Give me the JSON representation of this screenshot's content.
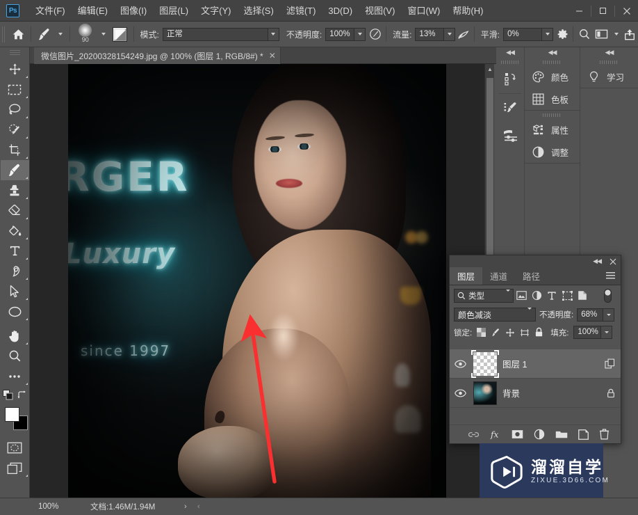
{
  "app": {
    "logo": "Ps",
    "name": "Adobe Photoshop"
  },
  "menubar": {
    "items": [
      {
        "label": "文件(F)"
      },
      {
        "label": "编辑(E)"
      },
      {
        "label": "图像(I)"
      },
      {
        "label": "图层(L)"
      },
      {
        "label": "文字(Y)"
      },
      {
        "label": "选择(S)"
      },
      {
        "label": "滤镜(T)"
      },
      {
        "label": "3D(D)"
      },
      {
        "label": "视图(V)"
      },
      {
        "label": "窗口(W)"
      },
      {
        "label": "帮助(H)"
      }
    ],
    "window_controls": {
      "minimize": "—",
      "maximize": "□",
      "close": "✕"
    }
  },
  "options_bar": {
    "home_icon": "home-icon",
    "brush_preset_icon": "brush-icon",
    "brush_size": "90",
    "brush_panel_icon": "brush-settings-icon",
    "mode_label": "模式:",
    "mode_value": "正常",
    "opacity_label": "不透明度:",
    "opacity_value": "100%",
    "pressure_opacity_icon": "pressure-opacity-icon",
    "flow_label": "流量:",
    "flow_value": "13%",
    "airbrush_icon": "airbrush-icon",
    "smoothing_label": "平滑:",
    "smoothing_value": "0%",
    "smoothing_options_icon": "gear-icon",
    "symmetry_icon": "search-icon",
    "tablet_pressure_icon": "panel-icon",
    "share_icon": "share-icon"
  },
  "document_tab": {
    "title": "微信图片_20200328154249.jpg @ 100% (图层 1, RGB/8#) *",
    "close": "✕"
  },
  "canvas": {
    "neon_line1": "RGER",
    "neon_line2": "Luxury",
    "neon_line3": "since 1997",
    "annotation": "red-arrow"
  },
  "status_bar": {
    "zoom": "100%",
    "doc_info": "文档:1.46M/1.94M",
    "next_arrow": "›",
    "prev_arrow": "‹"
  },
  "toolbar": {
    "tools": [
      {
        "name": "move-tool",
        "icon": "move-icon",
        "selected": false,
        "has_flyout": true
      },
      {
        "name": "rectangular-marquee-tool",
        "icon": "marquee-icon",
        "selected": false,
        "has_flyout": true
      },
      {
        "name": "lasso-tool",
        "icon": "lasso-icon",
        "selected": false,
        "has_flyout": true
      },
      {
        "name": "quick-selection-tool",
        "icon": "quick-select-icon",
        "selected": false,
        "has_flyout": true
      },
      {
        "name": "crop-tool",
        "icon": "crop-icon",
        "selected": false,
        "has_flyout": true
      },
      {
        "name": "brush-tool",
        "icon": "brush-icon",
        "selected": true,
        "has_flyout": true
      },
      {
        "name": "clone-stamp-tool",
        "icon": "stamp-icon",
        "selected": false,
        "has_flyout": true
      },
      {
        "name": "eraser-tool",
        "icon": "eraser-icon",
        "selected": false,
        "has_flyout": true
      },
      {
        "name": "gradient-tool",
        "icon": "paint-bucket-icon",
        "selected": false,
        "has_flyout": true
      },
      {
        "name": "type-tool",
        "icon": "text-icon",
        "selected": false,
        "has_flyout": true
      },
      {
        "name": "pen-tool",
        "icon": "pen-icon",
        "selected": false,
        "has_flyout": true
      },
      {
        "name": "path-selection-tool",
        "icon": "arrow-cursor-icon",
        "selected": false,
        "has_flyout": true
      },
      {
        "name": "ellipse-tool",
        "icon": "ellipse-icon",
        "selected": false,
        "has_flyout": true
      },
      {
        "name": "hand-tool",
        "icon": "hand-icon",
        "selected": false,
        "has_flyout": true
      },
      {
        "name": "zoom-tool",
        "icon": "magnifier-icon",
        "selected": false,
        "has_flyout": false
      },
      {
        "name": "edit-toolbar",
        "icon": "ellipsis-icon",
        "selected": false,
        "has_flyout": true
      }
    ],
    "foreground_color": "#ffffff",
    "background_color": "#000000",
    "quick_mask_icon": "quick-mask-icon",
    "screen_mode_icon": "screen-mode-icon"
  },
  "right_dock": {
    "mini_column": [
      {
        "name": "history-icon"
      },
      {
        "name": "brush-presets-icon"
      },
      {
        "name": "brush-settings-icon"
      }
    ],
    "group_a": [
      {
        "label": "颜色",
        "icon": "color-palette-icon"
      },
      {
        "label": "色板",
        "icon": "swatches-grid-icon"
      }
    ],
    "group_b": [
      {
        "label": "属性",
        "icon": "properties-icon"
      },
      {
        "label": "调整",
        "icon": "adjustments-icon"
      }
    ],
    "group_c": [
      {
        "label": "学习",
        "icon": "lightbulb-icon"
      }
    ]
  },
  "layers_panel": {
    "collapse_icon": "collapse-icon",
    "close_icon": "close-icon",
    "menu_icon": "panel-menu-icon",
    "tabs": [
      {
        "label": "图层",
        "active": true
      },
      {
        "label": "通道",
        "active": false
      },
      {
        "label": "路径",
        "active": false
      }
    ],
    "filter": {
      "search_icon": "search-icon",
      "kind_label": "类型",
      "icons": [
        {
          "name": "pixel-layer-filter-icon"
        },
        {
          "name": "adjustment-layer-filter-icon"
        },
        {
          "name": "type-layer-filter-icon"
        },
        {
          "name": "shape-layer-filter-icon"
        },
        {
          "name": "smart-object-filter-icon"
        }
      ],
      "toggle": "filter-toggle"
    },
    "blend_mode": "颜色减淡",
    "opacity_label": "不透明度:",
    "opacity_value": "68%",
    "lock_label": "锁定:",
    "lock_icons": [
      {
        "name": "lock-transparent-pixels-icon"
      },
      {
        "name": "lock-image-pixels-icon"
      },
      {
        "name": "lock-position-icon"
      },
      {
        "name": "lock-artboard-icon"
      },
      {
        "name": "lock-all-icon"
      }
    ],
    "fill_label": "填充:",
    "fill_value": "100%",
    "layers": [
      {
        "name": "图层 1",
        "visible": true,
        "selected": true,
        "thumb": "transparent",
        "right_icon": "release-clipping-icon"
      },
      {
        "name": "背景",
        "visible": true,
        "selected": false,
        "thumb": "photo",
        "right_icon": "lock-icon"
      }
    ],
    "bottom_buttons": [
      {
        "name": "link-layers-button",
        "icon": "link-icon"
      },
      {
        "name": "layer-style-button",
        "icon": "fx-icon"
      },
      {
        "name": "add-layer-mask-button",
        "icon": "mask-icon"
      },
      {
        "name": "new-fill-adjustment-button",
        "icon": "half-circle-icon"
      },
      {
        "name": "new-group-button",
        "icon": "folder-icon"
      },
      {
        "name": "new-layer-button",
        "icon": "new-layer-icon"
      },
      {
        "name": "delete-layer-button",
        "icon": "trash-icon"
      }
    ]
  },
  "watermark": {
    "icon": "play-logo-icon",
    "title": "溜溜自学",
    "subtitle": "ZIXUE.3D66.COM",
    "bg_color": "#2b3a5c"
  },
  "colors": {
    "chrome": "#535353",
    "chrome_dark": "#434343",
    "canvas_bg": "#262626",
    "accent_blue": "#4aa3df",
    "annotation_red": "#fa2f2f",
    "selected_tool_bg": "#6b6b6b"
  }
}
